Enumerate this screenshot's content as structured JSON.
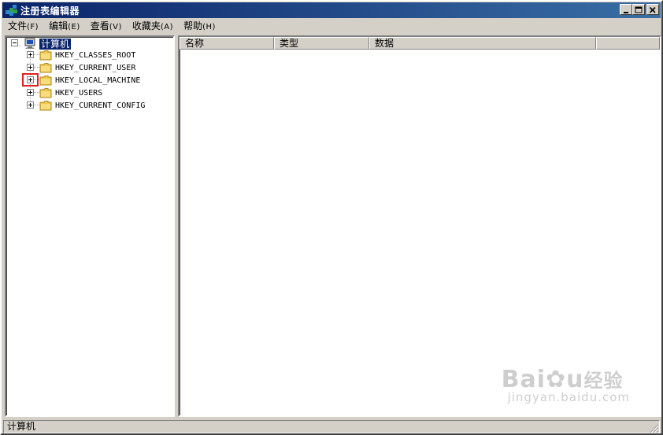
{
  "window": {
    "title": "注册表编辑器",
    "controls": {
      "minimize": "minimize",
      "maximize": "maximize",
      "close": "close"
    }
  },
  "menu": {
    "items": [
      {
        "label": "文件",
        "key": "(F)"
      },
      {
        "label": "编辑",
        "key": "(E)"
      },
      {
        "label": "查看",
        "key": "(V)"
      },
      {
        "label": "收藏夹",
        "key": "(A)"
      },
      {
        "label": "帮助",
        "key": "(H)"
      }
    ]
  },
  "tree": {
    "root": {
      "label": "计算机",
      "expanded": true,
      "selected": true,
      "icon": "computer-icon"
    },
    "children": [
      {
        "label": "HKEY_CLASSES_ROOT",
        "icon": "folder-icon",
        "expanded": false
      },
      {
        "label": "HKEY_CURRENT_USER",
        "icon": "folder-icon",
        "expanded": false
      },
      {
        "label": "HKEY_LOCAL_MACHINE",
        "icon": "folder-icon",
        "expanded": false,
        "highlighted": true
      },
      {
        "label": "HKEY_USERS",
        "icon": "folder-icon",
        "expanded": false
      },
      {
        "label": "HKEY_CURRENT_CONFIG",
        "icon": "folder-icon",
        "expanded": false
      }
    ]
  },
  "list": {
    "columns": [
      "名称",
      "类型",
      "数据"
    ]
  },
  "status": {
    "text": "计算机"
  },
  "watermark": {
    "brand_prefix": "Bai",
    "brand_suffix": "经验",
    "domain": "jingyan.baidu.com"
  },
  "colors": {
    "title_start": "#0a246a",
    "title_end": "#3a6ea5",
    "chrome": "#d4d0c8",
    "selection": "#0a246a",
    "annotation": "#e02020",
    "folder": "#f0c850"
  }
}
